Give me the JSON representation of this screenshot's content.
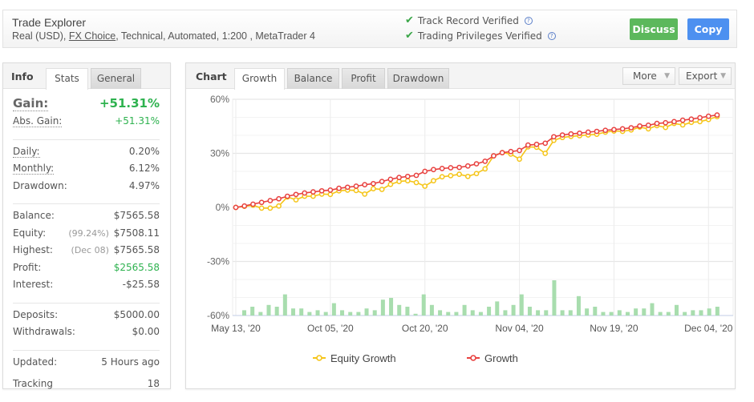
{
  "header": {
    "title": "Trade Explorer",
    "subtitle_prefix": "Real (USD), ",
    "broker_link": "FX Choice",
    "subtitle_suffix": ", Technical, Automated, 1:200 , MetaTrader 4",
    "verifications": [
      {
        "label": "Track Record Verified",
        "icon": "check-icon"
      },
      {
        "label": "Trading Privileges Verified",
        "icon": "check-icon"
      }
    ],
    "discuss_label": "Discuss",
    "copy_label": "Copy"
  },
  "info": {
    "title": "Info",
    "tabs": [
      {
        "label": "Stats",
        "active": true
      },
      {
        "label": "General",
        "active": false
      }
    ],
    "gain": {
      "label": "Gain:",
      "value": "+51.31%"
    },
    "abs_gain": {
      "label": "Abs. Gain:",
      "value": "+51.31%"
    },
    "daily": {
      "label": "Daily:",
      "value": "0.20%"
    },
    "monthly": {
      "label": "Monthly:",
      "value": "6.12%"
    },
    "drawdown": {
      "label": "Drawdown:",
      "value": "4.97%"
    },
    "balance": {
      "label": "Balance:",
      "value": "$7565.58"
    },
    "equity": {
      "label": "Equity:",
      "note": "(99.24%)",
      "value": "$7508.11"
    },
    "highest": {
      "label": "Highest:",
      "note": "(Dec 08)",
      "value": "$7565.58"
    },
    "profit": {
      "label": "Profit:",
      "value": "$2565.58"
    },
    "interest": {
      "label": "Interest:",
      "value": "-$25.58"
    },
    "deposits": {
      "label": "Deposits:",
      "value": "$5000.00"
    },
    "withdrawals": {
      "label": "Withdrawals:",
      "value": "$0.00"
    },
    "updated": {
      "label": "Updated:",
      "value": "5 Hours ago"
    },
    "tracking": {
      "label": "Tracking",
      "value": "18"
    }
  },
  "chart_panel": {
    "title": "Chart",
    "tabs": [
      {
        "label": "Growth",
        "active": true
      },
      {
        "label": "Balance",
        "active": false
      },
      {
        "label": "Profit",
        "active": false
      },
      {
        "label": "Drawdown",
        "active": false
      }
    ],
    "more_label": "More",
    "export_label": "Export"
  },
  "colors": {
    "equity": "#f5c518",
    "growth": "#e8413f",
    "bars": "#a8ddae",
    "positive": "#2eb24f",
    "discuss": "#5cb85c",
    "copy": "#4d90f0"
  },
  "chart_data": {
    "type": "line",
    "title": "",
    "xlabel": "",
    "ylabel": "",
    "ylim": [
      -60,
      60
    ],
    "yticks": [
      "60%",
      "30%",
      "0%",
      "-30%",
      "-60%"
    ],
    "ytick_values": [
      60,
      30,
      0,
      -30,
      -60
    ],
    "xtick_labels": [
      "May 13, '20",
      "Oct 05, '20",
      "Oct 20, '20",
      "Nov 04, '20",
      "Nov 19, '20",
      "Dec 04, '20"
    ],
    "xtick_indices": [
      0,
      11,
      22,
      33,
      44,
      55
    ],
    "grid": true,
    "legend_position": "bottom",
    "series": [
      {
        "name": "Growth",
        "values": [
          0,
          0.8,
          1.8,
          2.8,
          3.8,
          4.8,
          6.2,
          7.2,
          8.0,
          8.6,
          9.2,
          9.6,
          10.6,
          11.2,
          11.8,
          12.6,
          13.2,
          14.4,
          15.6,
          16.6,
          17.2,
          17.8,
          20.0,
          21.0,
          21.6,
          22.0,
          22.2,
          23.0,
          24.2,
          25.6,
          28.6,
          30.4,
          31.0,
          31.6,
          34.6,
          35.0,
          35.6,
          39.2,
          40.2,
          40.8,
          41.2,
          41.8,
          42.2,
          42.8,
          43.2,
          43.6,
          44.2,
          45.2,
          45.6,
          46.6,
          47.0,
          47.6,
          48.4,
          49.0,
          49.8,
          50.6,
          51.3
        ]
      },
      {
        "name": "Equity Growth",
        "values": [
          0,
          0.6,
          1.2,
          -0.4,
          -0.4,
          0.8,
          5.8,
          4.2,
          6.2,
          6.2,
          7.4,
          7.2,
          9.2,
          9.6,
          9.4,
          7.4,
          10.4,
          10.0,
          12.8,
          14.4,
          14.8,
          13.8,
          11.8,
          14.8,
          17.0,
          17.6,
          18.4,
          17.2,
          18.8,
          21.4,
          28.6,
          30.4,
          29.6,
          26.8,
          33.6,
          33.4,
          30.0,
          37.2,
          38.8,
          39.4,
          39.8,
          40.2,
          40.6,
          41.8,
          42.4,
          42.2,
          43.0,
          44.6,
          43.6,
          45.4,
          44.4,
          46.6,
          45.8,
          47.2,
          47.6,
          48.8,
          50.4
        ]
      },
      {
        "name": "Daily Profit (bars)",
        "values": [
          3,
          5,
          2,
          6,
          5,
          12,
          4,
          4,
          2,
          3,
          2,
          7,
          3,
          2,
          2,
          4,
          3,
          9,
          10,
          6,
          5,
          1,
          12,
          6,
          3,
          2,
          2,
          6,
          3,
          2,
          5,
          8,
          3,
          6,
          12,
          5,
          3,
          3,
          20,
          3,
          3,
          11,
          4,
          5,
          2,
          2,
          3,
          2,
          4,
          4,
          7,
          2,
          2,
          6,
          2,
          3,
          3,
          4,
          5
        ]
      }
    ]
  },
  "legend": [
    {
      "label": "Equity Growth",
      "series": "equity"
    },
    {
      "label": "Growth",
      "series": "growth"
    }
  ]
}
